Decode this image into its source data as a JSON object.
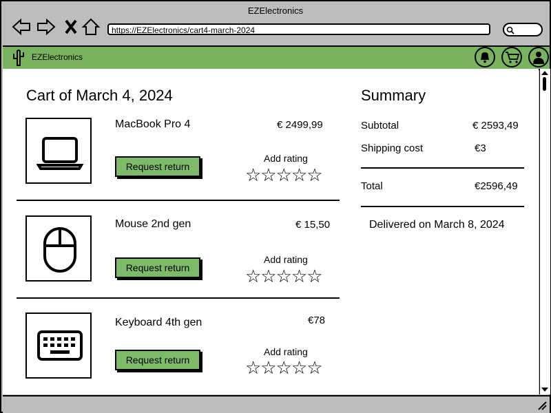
{
  "window": {
    "title": "EZElectronics",
    "url": "https://EZElectronics/cart4-march-2024"
  },
  "appbar": {
    "brand": "EZElectronics"
  },
  "page": {
    "title": "Cart of March 4, 2024"
  },
  "items": [
    {
      "name": "MacBook Pro 4",
      "price": "€ 2499,99",
      "icon": "laptop-icon",
      "return_label": "Request return",
      "rating_label": "Add rating",
      "stars": "☆☆☆☆☆",
      "rating": 0
    },
    {
      "name": "Mouse 2nd gen",
      "price": "€ 15,50",
      "icon": "mouse-icon",
      "return_label": "Request return",
      "rating_label": "Add rating",
      "stars": "☆☆☆☆☆",
      "rating": 0
    },
    {
      "name": "Keyboard 4th gen",
      "price": "€78",
      "icon": "keyboard-icon",
      "return_label": "Request return",
      "rating_label": "Add rating",
      "stars": "☆☆☆☆☆",
      "rating": 0
    }
  ],
  "summary": {
    "title": "Summary",
    "subtotal_label": "Subtotal",
    "subtotal": "€ 2593,49",
    "shipping_label": "Shipping cost",
    "shipping": "€3",
    "total_label": "Total",
    "total": "€2596,49",
    "delivered": "Delivered on March 8, 2024"
  },
  "colors": {
    "accent": "#79b35f",
    "button": "#7dbb6a",
    "chrome": "#bdbdbd"
  }
}
